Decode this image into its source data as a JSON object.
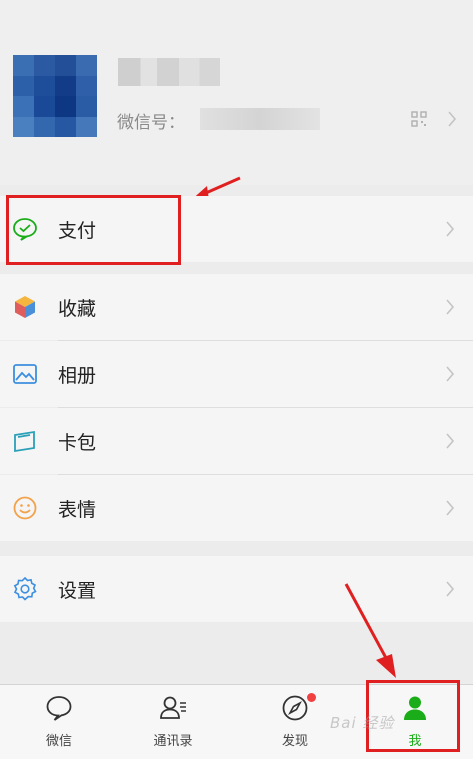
{
  "profile": {
    "wechat_id_label": "微信号："
  },
  "menu": {
    "pay": "支付",
    "favorites": "收藏",
    "album": "相册",
    "cards": "卡包",
    "stickers": "表情",
    "settings": "设置"
  },
  "tabbar": {
    "chats": "微信",
    "contacts": "通讯录",
    "discover": "发现",
    "me": "我"
  },
  "colors": {
    "accent_green": "#1aad19",
    "annotation_red": "#e02020"
  },
  "watermark": "Bai 经验",
  "icons": [
    "camera-icon",
    "qr-code-icon",
    "pay-icon",
    "favorites-icon",
    "album-icon",
    "cards-icon",
    "stickers-icon",
    "settings-icon",
    "chats-icon",
    "contacts-icon",
    "discover-icon",
    "me-icon",
    "chevron-right-icon"
  ]
}
